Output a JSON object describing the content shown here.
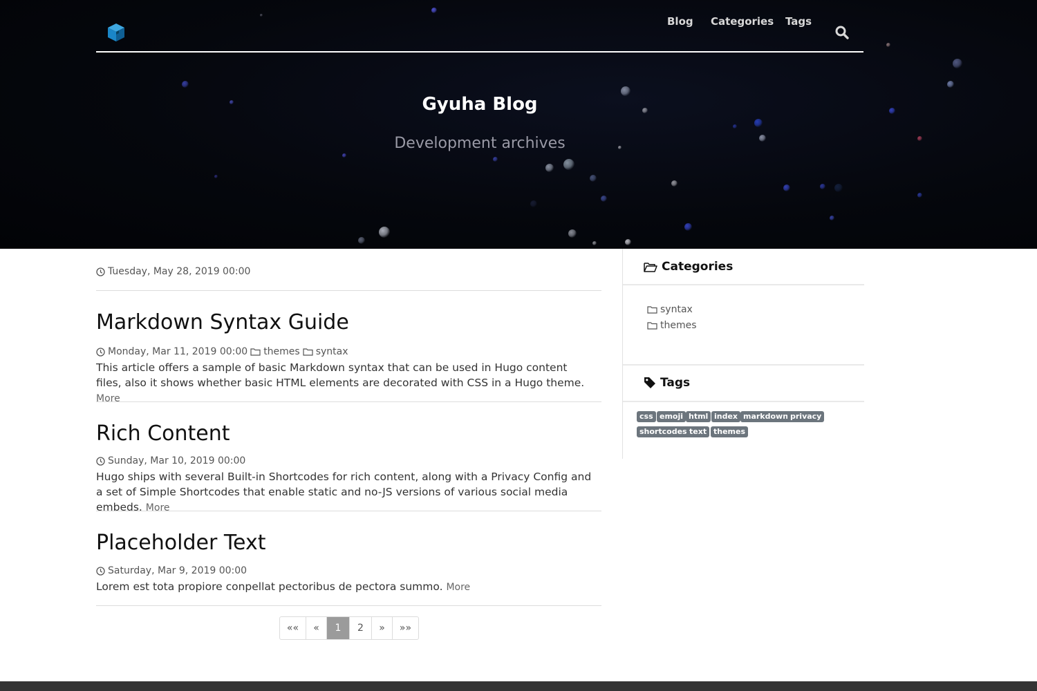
{
  "nav": {
    "logo": "cube-logo",
    "links": [
      "Blog",
      "Categories",
      "Tags"
    ],
    "search_icon": "search-icon"
  },
  "hero": {
    "title": "Gyuha Blog",
    "subtitle": "Development archives"
  },
  "main": {
    "first_date": "Tuesday, May 28, 2019 00:00",
    "posts": [
      {
        "title": "Markdown Syntax Guide",
        "date": "Monday, Mar 11, 2019 00:00",
        "categories": [
          "themes",
          "syntax"
        ],
        "summary": "This article offers a sample of basic Markdown syntax that can be used in Hugo content files, also it shows whether basic HTML elements are decorated with CSS in a Hugo theme.",
        "more": "More"
      },
      {
        "title": "Rich Content",
        "date": "Sunday, Mar 10, 2019 00:00",
        "categories": [],
        "summary": "Hugo ships with several Built-in Shortcodes for rich content, along with a Privacy Config and a set of Simple Shortcodes that enable static and no-JS versions of various social media embeds.",
        "more": "More"
      },
      {
        "title": "Placeholder Text",
        "date": "Saturday, Mar 9, 2019 00:00",
        "categories": [],
        "summary": "Lorem est tota propiore conpellat pectoribus de pectora summo.",
        "more": "More"
      }
    ]
  },
  "pagination": {
    "items": [
      "««",
      "«",
      "1",
      "2",
      "»",
      "»»"
    ],
    "current": "1"
  },
  "sidebar": {
    "categories_heading": "Categories",
    "categories": [
      "syntax",
      "themes"
    ],
    "tags_heading": "Tags",
    "tags": [
      "css",
      "emoji",
      "html",
      "index",
      "markdown",
      "privacy",
      "shortcodes",
      "text",
      "themes"
    ]
  },
  "colors": {
    "tag_bg": "#6c757d",
    "accent_blue": "#1a86c8",
    "page_active": "#9b9b9b",
    "footer": "#343434"
  }
}
